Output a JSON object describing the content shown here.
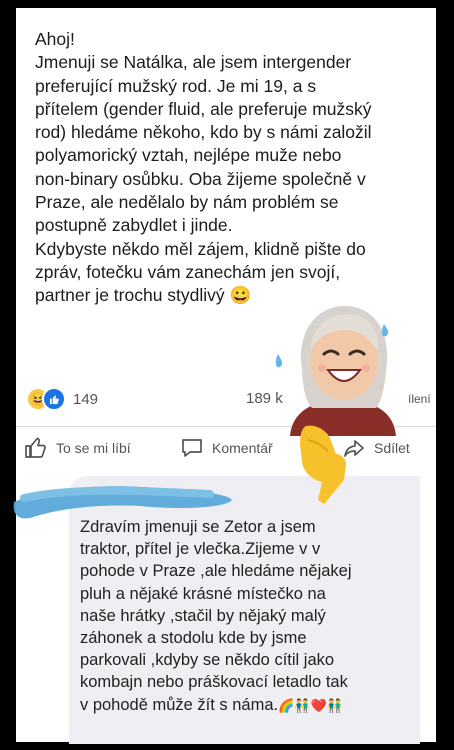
{
  "post": {
    "lines": [
      "Ahoj!",
      "Jmenuji se Natálka, ale jsem intergender",
      "preferující mužský rod. Je mi 19, a s",
      "přítelem (gender fluid, ale preferuje mužský",
      "rod) hledáme někoho, kdo by s námi založil",
      "polyamorický vztah, nejlépe muže nebo",
      "non-binary osůbku. Oba žijeme společně v",
      "Praze, ale nedělalo by nám problém se",
      "postupně zabydlet i jinde.",
      "Kdybyste někdo měl zájem, klidně pište do",
      "zpráv, fotečku vám zanechám jen svojí,",
      "partner je trochu stydlivý"
    ],
    "emoji_end": "😀",
    "reaction_count": "149",
    "comment_count": "189 k",
    "share_count_partial": "ílení"
  },
  "actions": {
    "like": "To se mi líbí",
    "comment": "Komentář",
    "share": "Sdílet"
  },
  "comment": {
    "lines": [
      "Zdravím jmenuji se Zetor a jsem",
      "traktor, přítel je vlečka.Zijeme v v",
      "pohode v Praze ,ale hledáme nějakej",
      "pluh a nějaké krásné místečko na",
      "naše hrátky ,stačil by nějaký malý",
      "záhonek a stodolu kde by jsme",
      "parkovali ,kdyby  se někdo cítil jako",
      "kombajn nebo práškovací letadlo tak",
      "v pohodě může žít s náma."
    ],
    "emoji_end": "🌈👬❤️👬"
  },
  "colors": {
    "accent_blue": "#1b74e4",
    "scribble_blue": "#58a8d8",
    "pointer_yellow": "#f6c12a"
  },
  "icons": [
    "haha-reaction-icon",
    "like-reaction-icon",
    "thumbs-up-icon",
    "comment-icon",
    "share-icon",
    "memoji-sticker",
    "pointing-finger-icon"
  ]
}
